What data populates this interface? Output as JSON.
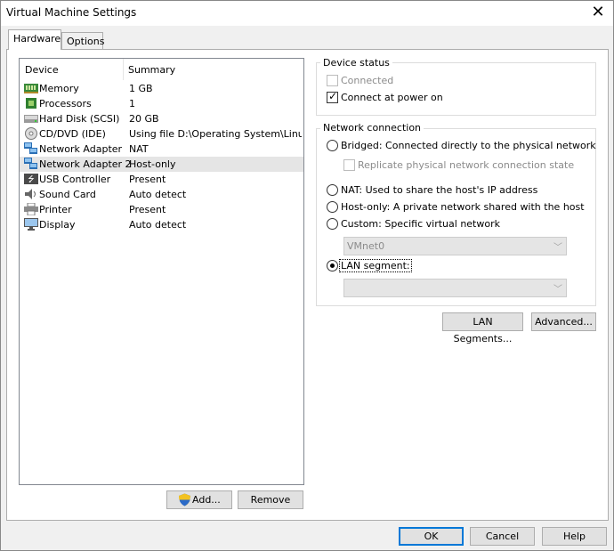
{
  "window": {
    "title": "Virtual Machine Settings"
  },
  "tabs": [
    {
      "label": "Hardware"
    },
    {
      "label": "Options"
    }
  ],
  "device_list": {
    "headers": {
      "device": "Device",
      "summary": "Summary"
    },
    "rows": [
      {
        "device": "Memory",
        "summary": "1 GB",
        "icon": "memory-icon"
      },
      {
        "device": "Processors",
        "summary": "1",
        "icon": "processor-icon"
      },
      {
        "device": "Hard Disk (SCSI)",
        "summary": "20 GB",
        "icon": "hard-disk-icon"
      },
      {
        "device": "CD/DVD (IDE)",
        "summary": "Using file D:\\Operating System\\Linux...",
        "icon": "cd-dvd-icon"
      },
      {
        "device": "Network Adapter",
        "summary": "NAT",
        "icon": "network-adapter-icon"
      },
      {
        "device": "Network Adapter 2",
        "summary": "Host-only",
        "icon": "network-adapter-icon"
      },
      {
        "device": "USB Controller",
        "summary": "Present",
        "icon": "usb-icon"
      },
      {
        "device": "Sound Card",
        "summary": "Auto detect",
        "icon": "speaker-icon"
      },
      {
        "device": "Printer",
        "summary": "Present",
        "icon": "printer-icon"
      },
      {
        "device": "Display",
        "summary": "Auto detect",
        "icon": "display-icon"
      }
    ],
    "add_label": "Add...",
    "remove_label": "Remove"
  },
  "device_status": {
    "title": "Device status",
    "connected_label": "Connected",
    "connected_checked": false,
    "connect_at_power_on_label": "Connect at power on",
    "connect_at_power_on_checked": true
  },
  "network_connection": {
    "title": "Network connection",
    "bridged_label": "Bridged: Connected directly to the physical network",
    "replicate_label": "Replicate physical network connection state",
    "nat_label": "NAT: Used to share the host's IP address",
    "host_only_label": "Host-only: A private network shared with the host",
    "custom_label": "Custom: Specific virtual network",
    "custom_select_value": "VMnet0",
    "lan_segment_label": "LAN segment:",
    "lan_segment_value": "",
    "selected": "LAN segment"
  },
  "buttons": {
    "lan_segments": "LAN Segments...",
    "advanced": "Advanced...",
    "ok": "OK",
    "cancel": "Cancel",
    "help": "Help"
  }
}
